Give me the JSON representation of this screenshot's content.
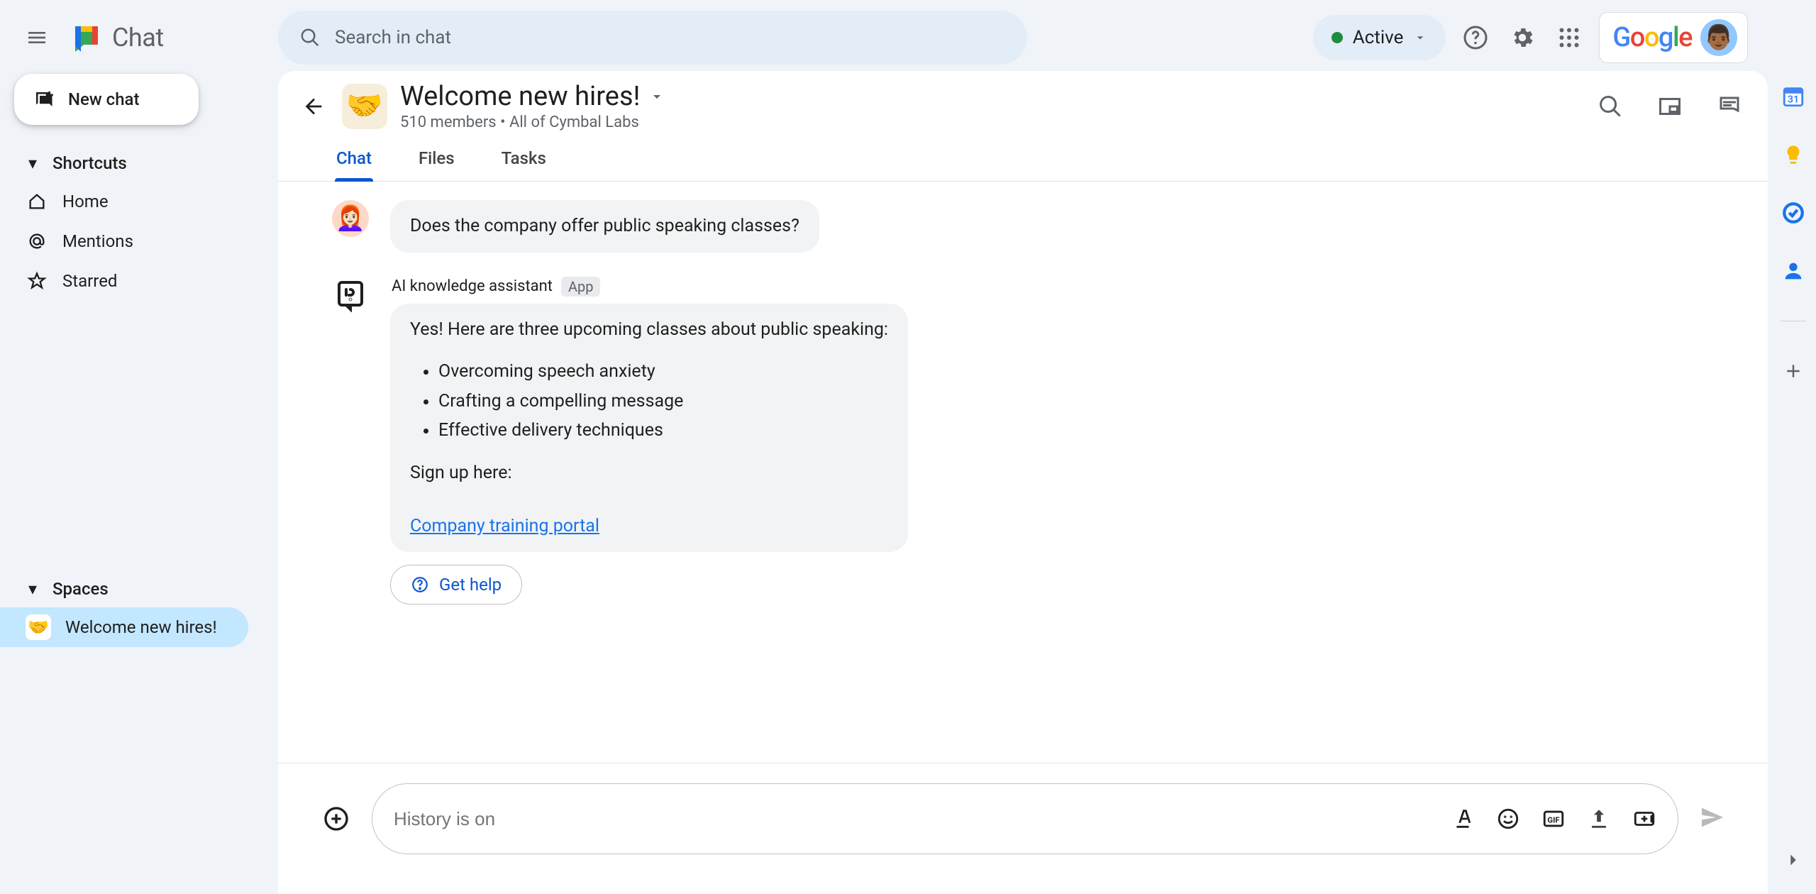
{
  "app_name": "Chat",
  "search": {
    "placeholder": "Search in chat"
  },
  "status": {
    "label": "Active"
  },
  "google_logo": "Google",
  "new_chat_label": "New chat",
  "nav": {
    "shortcuts_label": "Shortcuts",
    "items": [
      {
        "label": "Home"
      },
      {
        "label": "Mentions"
      },
      {
        "label": "Starred"
      }
    ],
    "spaces_label": "Spaces",
    "spaces": [
      {
        "emoji": "🤝",
        "label": "Welcome new hires!"
      }
    ]
  },
  "space": {
    "emoji": "🤝",
    "title": "Welcome new hires!",
    "subtitle": "510 members  •  All of Cymbal Labs"
  },
  "tabs": [
    {
      "label": "Chat",
      "active": true
    },
    {
      "label": "Files"
    },
    {
      "label": "Tasks"
    }
  ],
  "conversation": {
    "user_message": "Does the company offer public speaking classes?",
    "bot": {
      "name": "AI knowledge assistant",
      "badge": "App",
      "intro": "Yes! Here are three upcoming classes about public speaking:",
      "items": [
        "Overcoming speech anxiety",
        "Crafting a compelling message",
        "Effective delivery techniques"
      ],
      "signup_text": "Sign up here:",
      "link_text": "Company training portal",
      "get_help_label": "Get help"
    }
  },
  "composer": {
    "placeholder": "History is on"
  }
}
